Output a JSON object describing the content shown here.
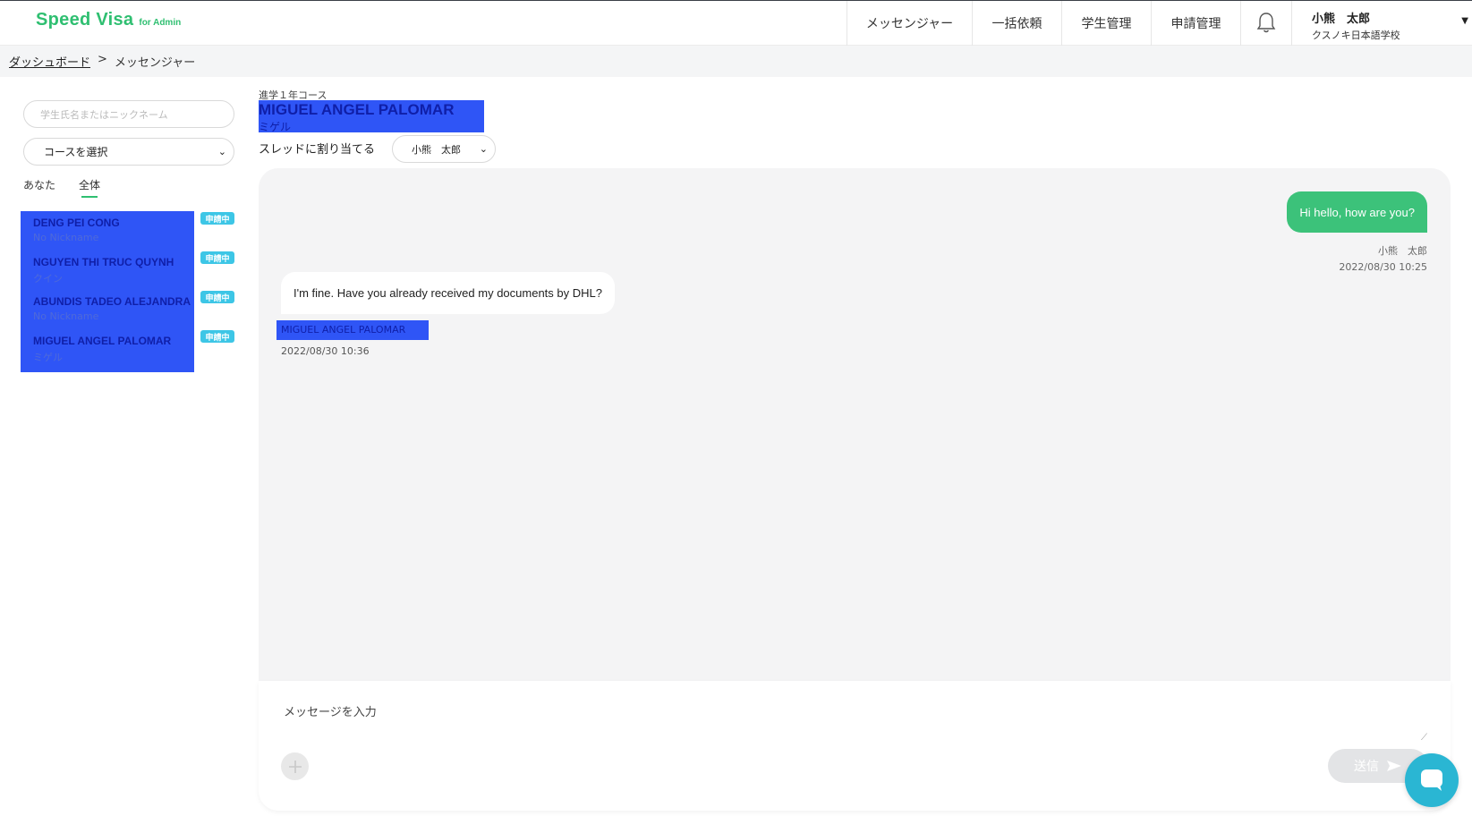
{
  "header": {
    "logo_main": "Speed Visa",
    "logo_sub": "for Admin",
    "nav": [
      "メッセンジャー",
      "一括依頼",
      "学生管理",
      "申請管理"
    ],
    "user_name": "小熊　太郎",
    "user_school": "クスノキ日本語学校"
  },
  "breadcrumb": {
    "home": "ダッシュボード",
    "separator": ">",
    "current": "メッセンジャー"
  },
  "sidebar": {
    "search_placeholder": "学生氏名またはニックネーム",
    "course_select": "コースを選択",
    "tabs": [
      "あなた",
      "全体"
    ],
    "active_tab": "全体",
    "students": [
      {
        "name": "DENG PEI CONG",
        "nickname": "No Nickname",
        "badge": "申請中"
      },
      {
        "name": "NGUYEN THI TRUC QUYNH",
        "nickname": "クイン",
        "badge": "申請中"
      },
      {
        "name": "ABUNDIS TADEO ALEJANDRA",
        "nickname": "No Nickname",
        "badge": "申請中"
      },
      {
        "name": "MIGUEL ANGEL PALOMAR",
        "nickname": "ミゲル",
        "badge": "申請中"
      }
    ]
  },
  "chat": {
    "course": "進学１年コース",
    "student_name": "MIGUEL ANGEL PALOMAR",
    "student_nickname": "ミゲル",
    "assign_label": "スレッドに割り当てる",
    "assignee": "小熊　太郎",
    "messages": [
      {
        "from": "me",
        "text": "Hi hello, how are you?",
        "sender": "小熊　太郎",
        "time": "2022/08/30 10:25"
      },
      {
        "from": "them",
        "text": "I'm fine. Have you already received my documents by DHL?",
        "sender": "MIGUEL ANGEL PALOMAR",
        "time": "2022/08/30 10:36"
      }
    ]
  },
  "composer": {
    "placeholder": "メッセージを入力",
    "send_label": "送信"
  },
  "colors": {
    "brand": "#2fbf71",
    "highlight": "#2f55f6",
    "badge": "#3dc6e6",
    "fab": "#2ab6d3"
  }
}
